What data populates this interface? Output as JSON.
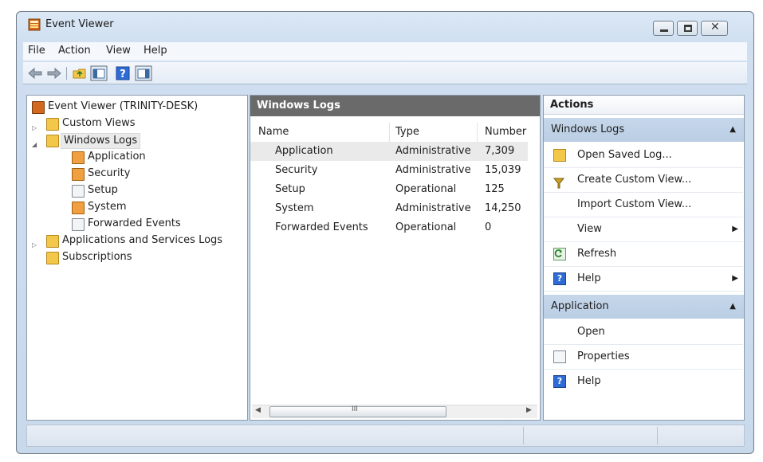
{
  "window": {
    "title": "Event Viewer"
  },
  "menubar": {
    "items": [
      "File",
      "Action",
      "View",
      "Help"
    ]
  },
  "toolbar": {
    "buttons": [
      "back-arrow-icon",
      "forward-arrow-icon",
      "folder-up-icon",
      "show-hide-console-tree-icon",
      "help-icon",
      "show-hide-action-pane-icon"
    ]
  },
  "tree": {
    "root": "Event Viewer (TRINITY-DESK)",
    "items": [
      {
        "label": "Custom Views"
      },
      {
        "label": "Windows Logs"
      },
      {
        "label": "Application"
      },
      {
        "label": "Security"
      },
      {
        "label": "Setup"
      },
      {
        "label": "System"
      },
      {
        "label": "Forwarded Events"
      },
      {
        "label": "Applications and Services Logs"
      },
      {
        "label": "Subscriptions"
      }
    ]
  },
  "list": {
    "header": "Windows Logs",
    "columns": [
      "Name",
      "Type",
      "Number"
    ],
    "rows": [
      {
        "name": "Application",
        "type": "Administrative",
        "number": "7,309"
      },
      {
        "name": "Security",
        "type": "Administrative",
        "number": "15,039"
      },
      {
        "name": "Setup",
        "type": "Operational",
        "number": "125"
      },
      {
        "name": "System",
        "type": "Administrative",
        "number": "14,250"
      },
      {
        "name": "Forwarded Events",
        "type": "Operational",
        "number": "0"
      }
    ],
    "scroll_thumb": "III"
  },
  "actions": {
    "header": "Actions",
    "groups": [
      {
        "label": "Windows Logs",
        "items": [
          "Open Saved Log...",
          "Create Custom View...",
          "Import Custom View...",
          "View",
          "Refresh",
          "Help"
        ]
      },
      {
        "label": "Application",
        "items": [
          "Open",
          "Properties",
          "Help"
        ]
      }
    ]
  },
  "colors": {
    "accent": "#c6d7ea",
    "list_header": "#6a6a6a",
    "selection": "#eaeaea"
  }
}
